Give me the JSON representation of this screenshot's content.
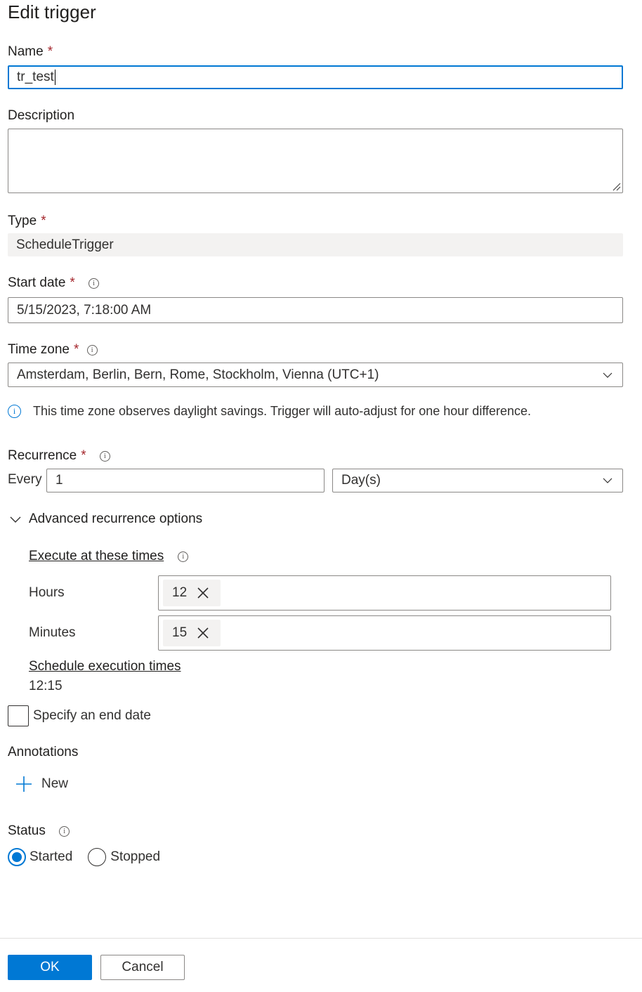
{
  "dialog": {
    "title": "Edit trigger"
  },
  "name": {
    "label": "Name",
    "required": "*",
    "value": "tr_test"
  },
  "description": {
    "label": "Description",
    "value": ""
  },
  "type": {
    "label": "Type",
    "required": "*",
    "value": "ScheduleTrigger"
  },
  "start_date": {
    "label": "Start date",
    "required": "*",
    "value": "5/15/2023, 7:18:00 AM"
  },
  "time_zone": {
    "label": "Time zone",
    "required": "*",
    "value": "Amsterdam, Berlin, Bern, Rome, Stockholm, Vienna (UTC+1)",
    "note": "This time zone observes daylight savings. Trigger will auto-adjust for one hour difference."
  },
  "recurrence": {
    "label": "Recurrence",
    "required": "*",
    "every_label": "Every",
    "interval": "1",
    "unit": "Day(s)"
  },
  "advanced": {
    "toggle_label": "Advanced recurrence options",
    "execute_label": "Execute at these times",
    "hours_label": "Hours",
    "hours_tags": [
      "12"
    ],
    "minutes_label": "Minutes",
    "minutes_tags": [
      "15"
    ],
    "schedule_label": "Schedule execution times",
    "schedule_times": "12:15"
  },
  "end_date": {
    "label": "Specify an end date",
    "checked": false
  },
  "annotations": {
    "label": "Annotations",
    "new_label": "New"
  },
  "status": {
    "label": "Status",
    "options": [
      {
        "label": "Started",
        "checked": true
      },
      {
        "label": "Stopped",
        "checked": false
      }
    ]
  },
  "footer": {
    "ok_label": "OK",
    "cancel_label": "Cancel"
  },
  "colors": {
    "accent": "#0078d4",
    "required": "#a4262c",
    "readonly_bg": "#f3f2f1",
    "border": "#8a8886"
  },
  "icons": {
    "info": "info-icon",
    "chevron": "chevron-down-icon",
    "remove": "close-icon",
    "add": "plus-icon"
  }
}
